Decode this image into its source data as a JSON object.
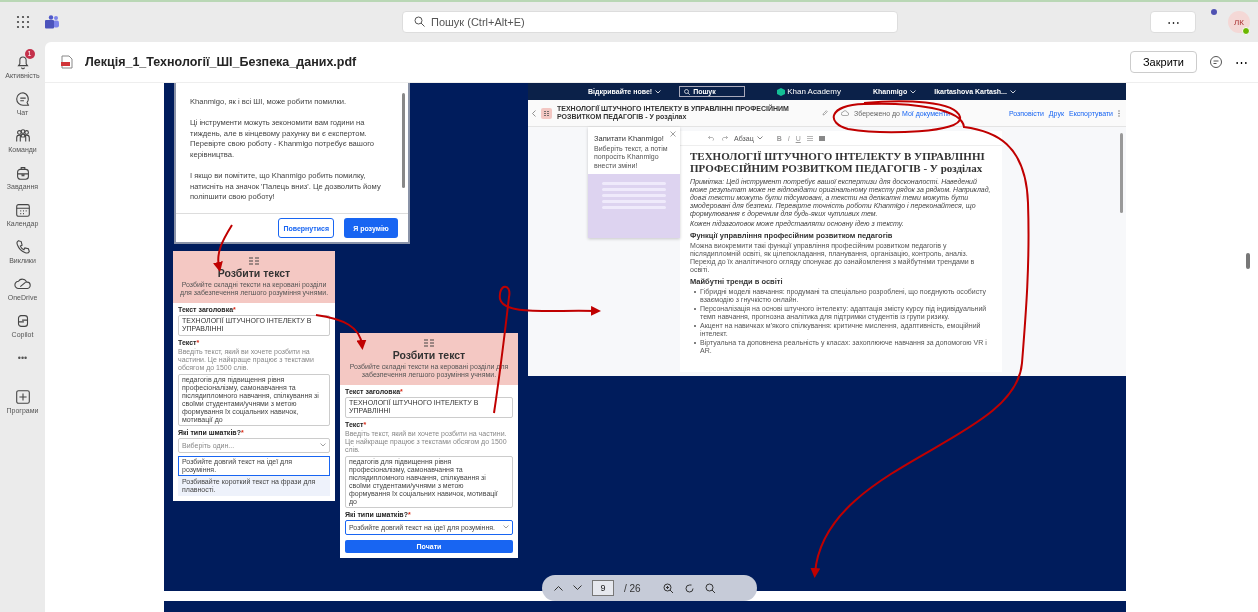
{
  "top_bar": {
    "search": {
      "placeholder": "Пошук (Ctrl+Alt+E)"
    },
    "more": "⋯",
    "avatar": "ЛК"
  },
  "rail": [
    {
      "label": "Активність",
      "badge": "1"
    },
    {
      "label": "Чат"
    },
    {
      "label": "Команди"
    },
    {
      "label": "Завдання"
    },
    {
      "label": "Календар"
    },
    {
      "label": "Виклики"
    },
    {
      "label": "OneDrive"
    },
    {
      "label": "Copilot"
    },
    {
      "label": "•••"
    },
    {
      "label": "Програми"
    }
  ],
  "file": {
    "title": "Лекція_1_Технології_ШІ_Безпека_даних.pdf",
    "close": "Закрити",
    "more": "⋯"
  },
  "slide": {
    "dialog": {
      "paragraphs": [
        "Khanmigo, як і всі ШІ, може робити помилки.",
        "Ці інструменти можуть зекономити вам години на тиждень, але в кінцевому рахунку ви є експертом. Перевірте свою роботу - Khanmigo потребує вашого керівництва.",
        "І якщо ви помітите, що Khanmigo робить помилку, натисніть на значок 'Палець вниз'. Це дозволить йому поліпшити свою роботу!"
      ],
      "buttons": [
        {
          "label": "Повернутися",
          "kind": "outline"
        },
        {
          "label": "Я розумію",
          "kind": "primary"
        }
      ]
    },
    "cards": [
      {
        "title": "Розбити текст",
        "description": "Розбийте складні тексти на керовані розділи для забезпечення легшого розуміння учнями.",
        "required_mark": "*",
        "heading_label": "Текст заголовка",
        "heading_value": "ТЕХНОЛОГІЇ ШТУЧНОГО ІНТЕЛЕКТУ В УПРАВЛІННІ",
        "text_label": "Текст",
        "text_hint": "Введіть текст, який ви хочете розбити на частини. Це найкраще працює з текстами обсягом до 1500 слів.",
        "text_value": "педагогів для підвищення рівня професіоналізму, самонавчання та післядипломного навчання, спілкування зі своїми студентами/учнями з метою формування їх соціальних навичок, мотивації до",
        "chunks_label": "Які типи шматків?",
        "chunks": {
          "placeholder": "Виберіть один..."
        },
        "options": [
          {
            "label": "Розбийте довгий текст на ідеї для розуміння.",
            "selected": true
          },
          {
            "label": "Розбивайте короткий текст на фрази для плавності.",
            "selected": false
          }
        ]
      },
      {
        "title": "Розбити текст",
        "description": "Розбийте складні тексти на керовані розділи для забезпечення легшого розуміння учнями.",
        "required_mark": "*",
        "heading_label": "Текст заголовка",
        "heading_value": "ТЕХНОЛОГІЇ ШТУЧНОГО ІНТЕЛЕКТУ В УПРАВЛІННІ",
        "text_label": "Текст",
        "text_hint": "Введіть текст, який ви хочете розбити на частини. Це найкраще працює з текстами обсягом до 1500 слів.",
        "text_value": "педагогів для підвищення рівня професіоналізму, самонавчання та післядипломного навчання, спілкування зі своїми студентами/учнями з метою формування їх соціальних навичок, мотивації до",
        "chunks_label": "Які типи шматків?",
        "chunks": {
          "value": "Розбийте довгий текст на ідеї для розуміння."
        },
        "start_button": "Почати"
      }
    ],
    "khan": {
      "nav": {
        "explore": "Відкривайте нове!",
        "search": "Пошук",
        "logo": "Khan Academy",
        "khanmigo": "Khanmigo",
        "user": "Ikartashova Kartash..."
      },
      "doc_title": "ТЕХНОЛОГІЇ ШТУЧНОГО ІНТЕЛЕКТУ В УПРАВЛІННІ ПРОФЕСІЙНИМ РОЗВИТКОМ ПЕДАГОГІВ - У розділах",
      "saved": "Збережено до",
      "saved_link": "Мої документи",
      "actions": [
        "Розповісти",
        "Друк",
        "Експортувати"
      ],
      "popup": {
        "title": "Запитати Khanmigo!",
        "text": "Виберіть текст, а потім попросіть Khanmigo внести зміни!"
      },
      "paragraph_style": "Абзац",
      "format_buttons": [
        "B",
        "I",
        "U"
      ],
      "heading": "ТЕХНОЛОГІЇ ШТУЧНОГО ІНТЕЛЕКТУ В УПРАВЛІННІ ПРОФЕСІЙНИМ РОЗВИТКОМ ПЕДАГОГІВ - У розділах",
      "notes": [
        "Примітка: Цей інструмент потребує вашої експертизи для досконалості. Наведений може результат може не відповідати оригінальному тексту рядок за рядком. Наприклад, довгі тексти можуть бути підсумовані, а тексти на делікатні теми можуть бути змодеровані для безпеки. Перевірте точність роботи Khanmigo і переконайтеся, що формулювання є доречним для будь-яких чутливих тем.",
        "Кожен підзаголовок може представляти основну ідею з тексту."
      ],
      "sections": [
        {
          "heading": "Функції управління професійним розвитком педагогів",
          "text": "Можна виокремити такі функції управління професійним розвитком педагогів у післядипломній освіті, як цілепокладання, планування, організацію, контроль, аналіз. Перехід до їх аналітичного огляду спонукає до ознайомлення з майбутніми трендами в освіті."
        },
        {
          "heading": "Майбутні тренди в освіті",
          "bullets": [
            "Гібридні моделі навчання: продумані та спеціально розроблені, що поєднують особисту взаємодію з гнучкістю онлайн.",
            "Персоналізація на основі штучного інтелекту: адаптація змісту курсу під індивідуальний темп навчання, прогнозна аналітика для підтримки студентів із групи ризику.",
            "Акцент на навичках м'якого спілкування: критичне мислення, адаптивність, емоційний інтелект.",
            "Віртуальна та доповнена реальність у класах: захоплююче навчання за допомогою VR і AR."
          ]
        }
      ]
    }
  },
  "pager": {
    "page": "9",
    "total": "/ 26"
  }
}
